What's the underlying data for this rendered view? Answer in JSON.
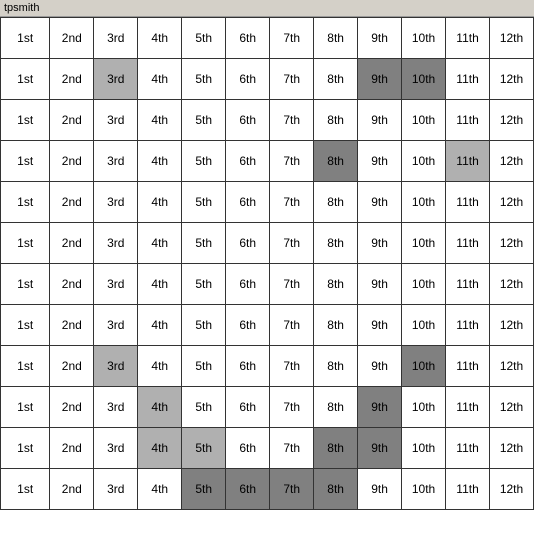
{
  "title": "tpsmith",
  "columns": [
    "1st",
    "2nd",
    "3rd",
    "4th",
    "5th",
    "6th",
    "7th",
    "8th",
    "9th",
    "10th",
    "11th",
    "12th"
  ],
  "rows": [
    {
      "cells": [
        {
          "val": "1st",
          "bg": "white"
        },
        {
          "val": "2nd",
          "bg": "white"
        },
        {
          "val": "3rd",
          "bg": "white"
        },
        {
          "val": "4th",
          "bg": "white"
        },
        {
          "val": "5th",
          "bg": "white"
        },
        {
          "val": "6th",
          "bg": "white"
        },
        {
          "val": "7th",
          "bg": "white"
        },
        {
          "val": "8th",
          "bg": "white"
        },
        {
          "val": "9th",
          "bg": "white"
        },
        {
          "val": "10th",
          "bg": "white"
        },
        {
          "val": "11th",
          "bg": "white"
        },
        {
          "val": "12th",
          "bg": "white"
        }
      ]
    },
    {
      "cells": [
        {
          "val": "1st",
          "bg": "white"
        },
        {
          "val": "2nd",
          "bg": "white"
        },
        {
          "val": "3rd",
          "bg": "gray"
        },
        {
          "val": "4th",
          "bg": "white"
        },
        {
          "val": "5th",
          "bg": "white"
        },
        {
          "val": "6th",
          "bg": "white"
        },
        {
          "val": "7th",
          "bg": "white"
        },
        {
          "val": "8th",
          "bg": "white"
        },
        {
          "val": "9th",
          "bg": "darkgray"
        },
        {
          "val": "10th",
          "bg": "darkgray"
        },
        {
          "val": "11th",
          "bg": "white"
        },
        {
          "val": "12th",
          "bg": "white"
        }
      ]
    },
    {
      "cells": [
        {
          "val": "1st",
          "bg": "white"
        },
        {
          "val": "2nd",
          "bg": "white"
        },
        {
          "val": "3rd",
          "bg": "white"
        },
        {
          "val": "4th",
          "bg": "white"
        },
        {
          "val": "5th",
          "bg": "white"
        },
        {
          "val": "6th",
          "bg": "white"
        },
        {
          "val": "7th",
          "bg": "white"
        },
        {
          "val": "8th",
          "bg": "white"
        },
        {
          "val": "9th",
          "bg": "white"
        },
        {
          "val": "10th",
          "bg": "white"
        },
        {
          "val": "11th",
          "bg": "white"
        },
        {
          "val": "12th",
          "bg": "white"
        }
      ]
    },
    {
      "cells": [
        {
          "val": "1st",
          "bg": "white"
        },
        {
          "val": "2nd",
          "bg": "white"
        },
        {
          "val": "3rd",
          "bg": "white"
        },
        {
          "val": "4th",
          "bg": "white"
        },
        {
          "val": "5th",
          "bg": "white"
        },
        {
          "val": "6th",
          "bg": "white"
        },
        {
          "val": "7th",
          "bg": "white"
        },
        {
          "val": "8th",
          "bg": "darkgray"
        },
        {
          "val": "9th",
          "bg": "white"
        },
        {
          "val": "10th",
          "bg": "white"
        },
        {
          "val": "11th",
          "bg": "gray"
        },
        {
          "val": "12th",
          "bg": "white"
        }
      ]
    },
    {
      "cells": [
        {
          "val": "1st",
          "bg": "white"
        },
        {
          "val": "2nd",
          "bg": "white"
        },
        {
          "val": "3rd",
          "bg": "white"
        },
        {
          "val": "4th",
          "bg": "white"
        },
        {
          "val": "5th",
          "bg": "white"
        },
        {
          "val": "6th",
          "bg": "white"
        },
        {
          "val": "7th",
          "bg": "white"
        },
        {
          "val": "8th",
          "bg": "white"
        },
        {
          "val": "9th",
          "bg": "white"
        },
        {
          "val": "10th",
          "bg": "white"
        },
        {
          "val": "11th",
          "bg": "white"
        },
        {
          "val": "12th",
          "bg": "white"
        }
      ]
    },
    {
      "cells": [
        {
          "val": "1st",
          "bg": "white"
        },
        {
          "val": "2nd",
          "bg": "white"
        },
        {
          "val": "3rd",
          "bg": "white"
        },
        {
          "val": "4th",
          "bg": "white"
        },
        {
          "val": "5th",
          "bg": "white"
        },
        {
          "val": "6th",
          "bg": "white"
        },
        {
          "val": "7th",
          "bg": "white"
        },
        {
          "val": "8th",
          "bg": "white"
        },
        {
          "val": "9th",
          "bg": "white"
        },
        {
          "val": "10th",
          "bg": "white"
        },
        {
          "val": "11th",
          "bg": "white"
        },
        {
          "val": "12th",
          "bg": "white"
        }
      ]
    },
    {
      "cells": [
        {
          "val": "1st",
          "bg": "white"
        },
        {
          "val": "2nd",
          "bg": "white"
        },
        {
          "val": "3rd",
          "bg": "white"
        },
        {
          "val": "4th",
          "bg": "white"
        },
        {
          "val": "5th",
          "bg": "white"
        },
        {
          "val": "6th",
          "bg": "white"
        },
        {
          "val": "7th",
          "bg": "white"
        },
        {
          "val": "8th",
          "bg": "white"
        },
        {
          "val": "9th",
          "bg": "white"
        },
        {
          "val": "10th",
          "bg": "white"
        },
        {
          "val": "11th",
          "bg": "white"
        },
        {
          "val": "12th",
          "bg": "white"
        }
      ]
    },
    {
      "cells": [
        {
          "val": "1st",
          "bg": "white"
        },
        {
          "val": "2nd",
          "bg": "white"
        },
        {
          "val": "3rd",
          "bg": "white"
        },
        {
          "val": "4th",
          "bg": "white"
        },
        {
          "val": "5th",
          "bg": "white"
        },
        {
          "val": "6th",
          "bg": "white"
        },
        {
          "val": "7th",
          "bg": "white"
        },
        {
          "val": "8th",
          "bg": "white"
        },
        {
          "val": "9th",
          "bg": "white"
        },
        {
          "val": "10th",
          "bg": "white"
        },
        {
          "val": "11th",
          "bg": "white"
        },
        {
          "val": "12th",
          "bg": "white"
        }
      ]
    },
    {
      "cells": [
        {
          "val": "1st",
          "bg": "white"
        },
        {
          "val": "2nd",
          "bg": "white"
        },
        {
          "val": "3rd",
          "bg": "gray"
        },
        {
          "val": "4th",
          "bg": "white"
        },
        {
          "val": "5th",
          "bg": "white"
        },
        {
          "val": "6th",
          "bg": "white"
        },
        {
          "val": "7th",
          "bg": "white"
        },
        {
          "val": "8th",
          "bg": "white"
        },
        {
          "val": "9th",
          "bg": "white"
        },
        {
          "val": "10th",
          "bg": "darkgray"
        },
        {
          "val": "11th",
          "bg": "white"
        },
        {
          "val": "12th",
          "bg": "white"
        }
      ]
    },
    {
      "cells": [
        {
          "val": "1st",
          "bg": "white"
        },
        {
          "val": "2nd",
          "bg": "white"
        },
        {
          "val": "3rd",
          "bg": "white"
        },
        {
          "val": "4th",
          "bg": "gray"
        },
        {
          "val": "5th",
          "bg": "white"
        },
        {
          "val": "6th",
          "bg": "white"
        },
        {
          "val": "7th",
          "bg": "white"
        },
        {
          "val": "8th",
          "bg": "white"
        },
        {
          "val": "9th",
          "bg": "darkgray"
        },
        {
          "val": "10th",
          "bg": "white"
        },
        {
          "val": "11th",
          "bg": "white"
        },
        {
          "val": "12th",
          "bg": "white"
        }
      ]
    },
    {
      "cells": [
        {
          "val": "1st",
          "bg": "white"
        },
        {
          "val": "2nd",
          "bg": "white"
        },
        {
          "val": "3rd",
          "bg": "white"
        },
        {
          "val": "4th",
          "bg": "gray"
        },
        {
          "val": "5th",
          "bg": "gray"
        },
        {
          "val": "6th",
          "bg": "white"
        },
        {
          "val": "7th",
          "bg": "white"
        },
        {
          "val": "8th",
          "bg": "darkgray"
        },
        {
          "val": "9th",
          "bg": "darkgray"
        },
        {
          "val": "10th",
          "bg": "white"
        },
        {
          "val": "11th",
          "bg": "white"
        },
        {
          "val": "12th",
          "bg": "white"
        }
      ]
    },
    {
      "cells": [
        {
          "val": "1st",
          "bg": "white"
        },
        {
          "val": "2nd",
          "bg": "white"
        },
        {
          "val": "3rd",
          "bg": "white"
        },
        {
          "val": "4th",
          "bg": "white"
        },
        {
          "val": "5th",
          "bg": "darkgray"
        },
        {
          "val": "6th",
          "bg": "darkgray"
        },
        {
          "val": "7th",
          "bg": "darkgray"
        },
        {
          "val": "8th",
          "bg": "darkgray"
        },
        {
          "val": "9th",
          "bg": "white"
        },
        {
          "val": "10th",
          "bg": "white"
        },
        {
          "val": "11th",
          "bg": "white"
        },
        {
          "val": "12th",
          "bg": "white"
        }
      ]
    }
  ]
}
